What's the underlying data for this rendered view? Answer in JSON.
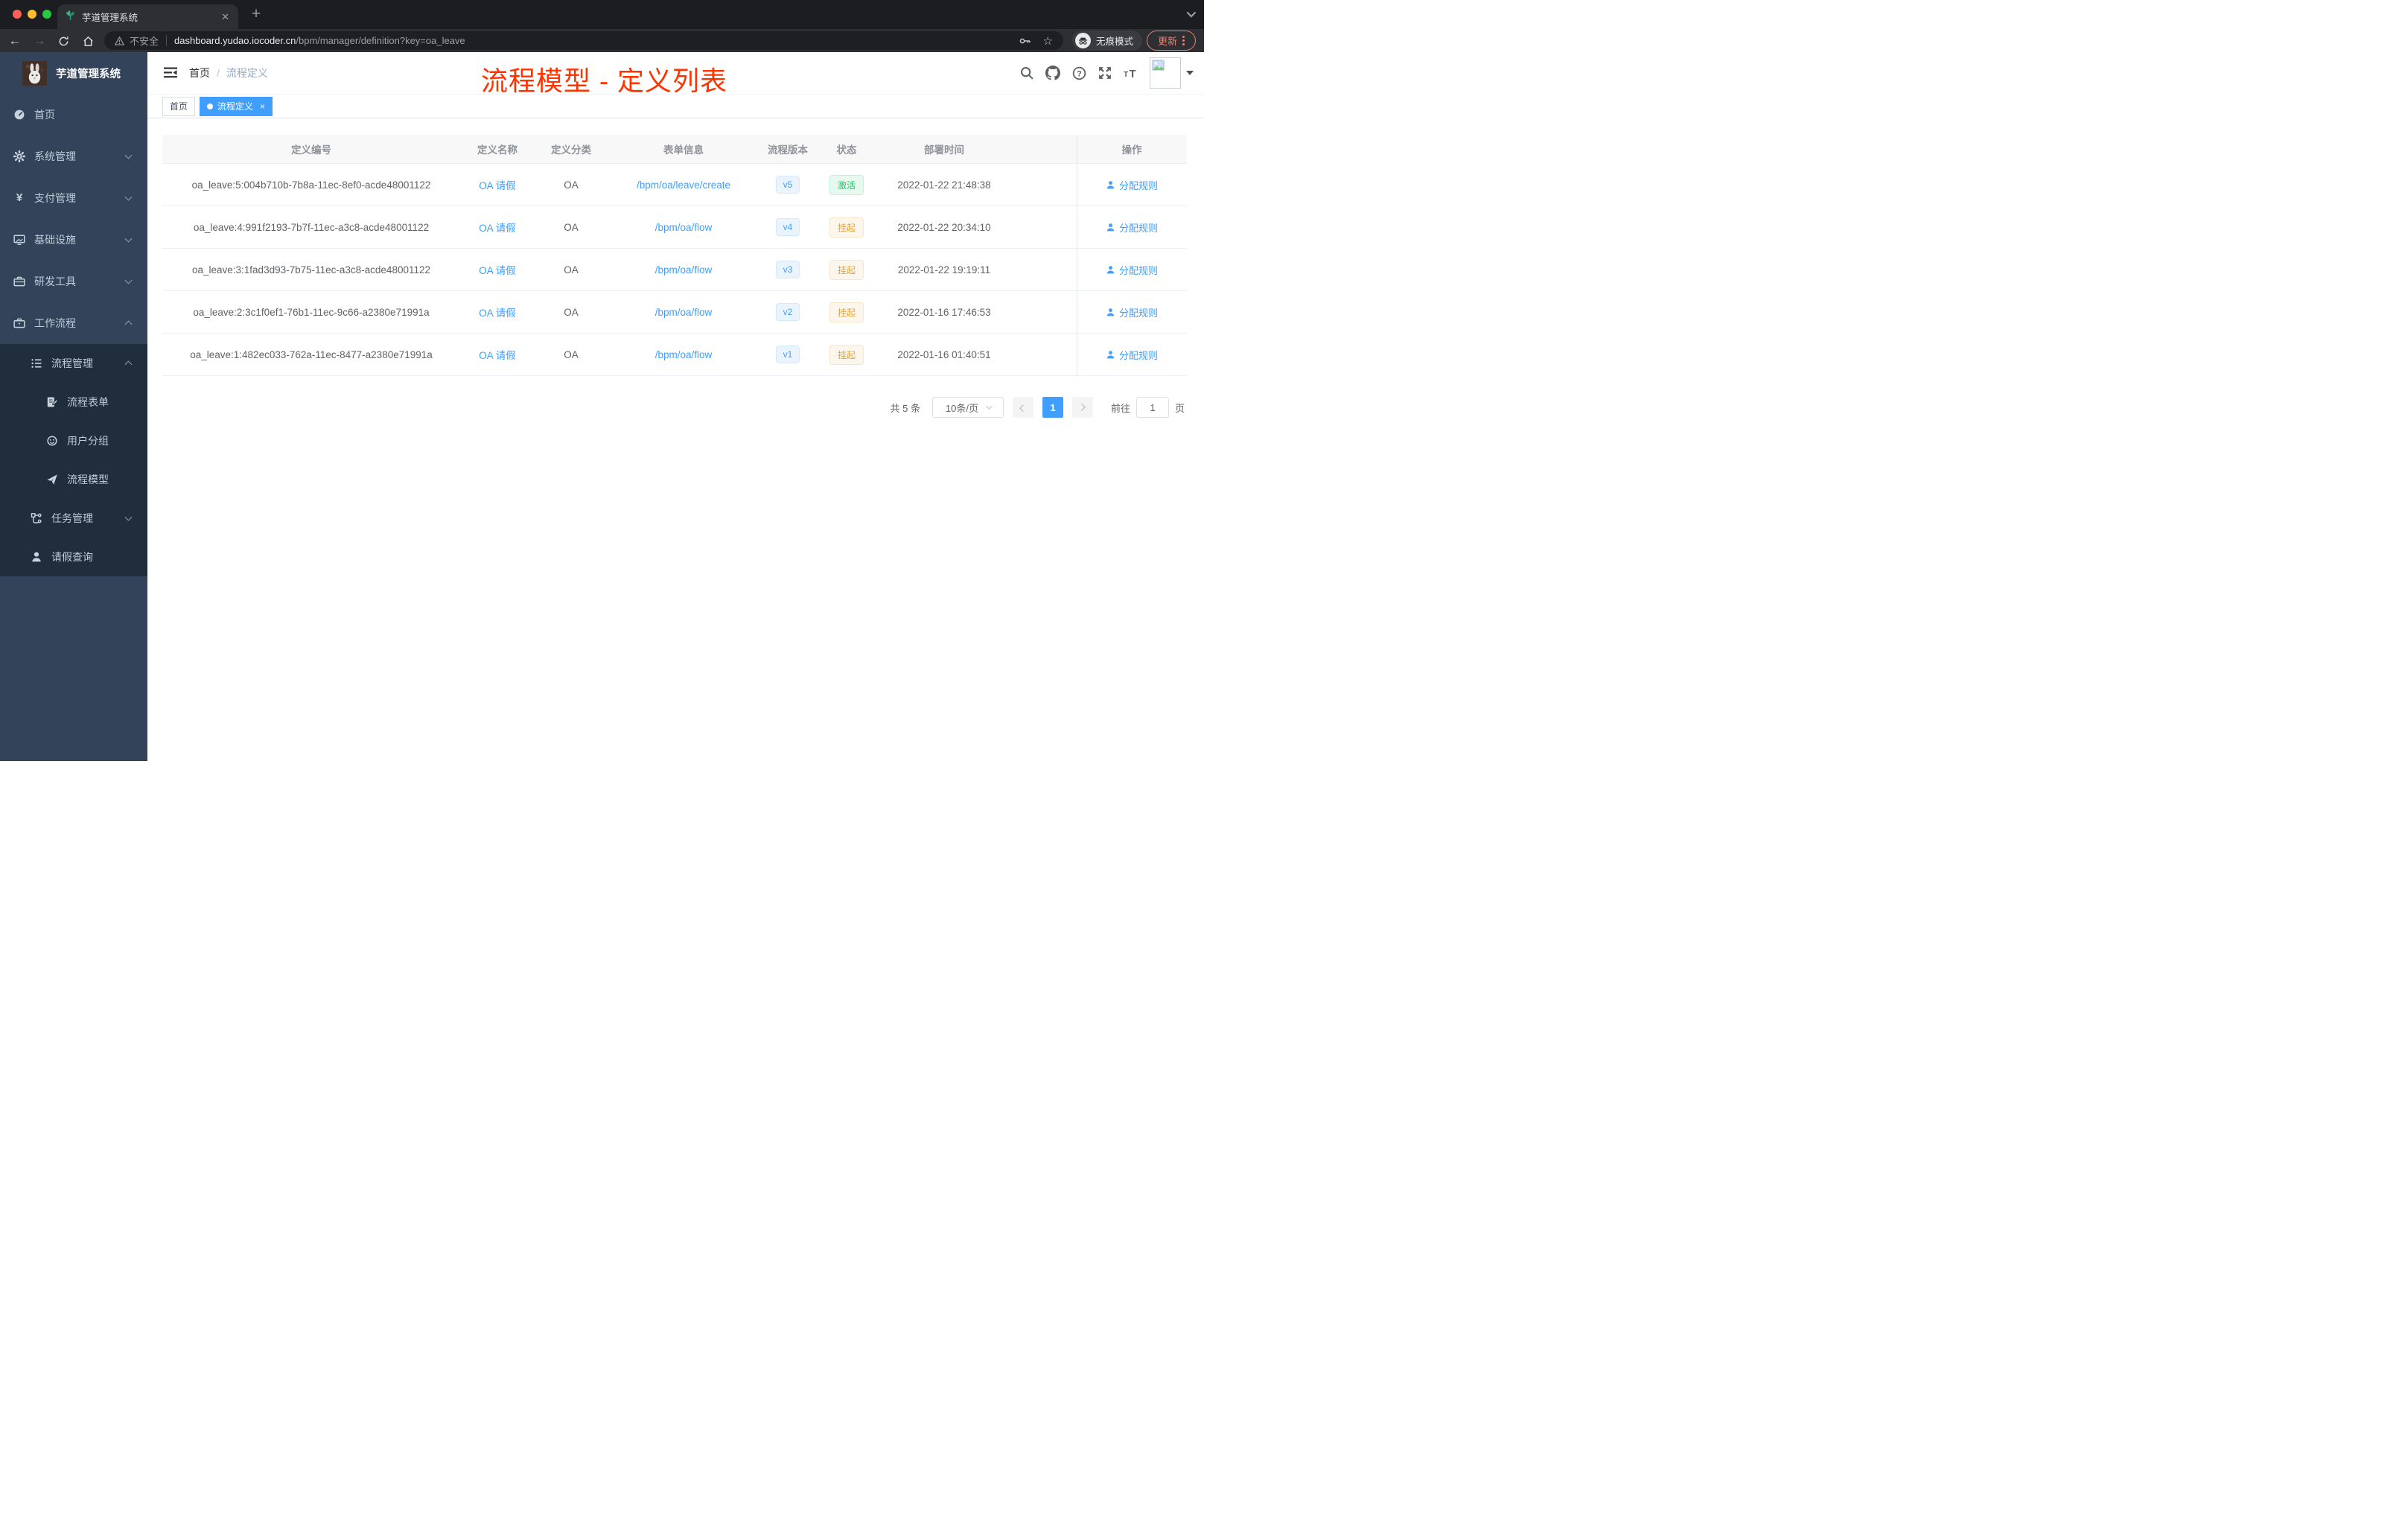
{
  "colors": {
    "accent": "#409eff",
    "success": "#13ce66",
    "warning": "#e6a23c",
    "annotation_red": "#ff3300",
    "sidebar_bg": "#33445a",
    "submenu_bg": "#1f2d3d"
  },
  "browser": {
    "tab_title": "芋道管理系统",
    "security_label": "不安全",
    "url_host": "dashboard.yudao.iocoder.cn",
    "url_path": "/bpm/manager/definition?key=oa_leave",
    "incognito_label": "无痕模式",
    "update_label": "更新"
  },
  "sidebar": {
    "logo_title": "芋道管理系统",
    "items": [
      {
        "key": "home",
        "icon": "dashboard-icon",
        "label": "首页",
        "level": 0,
        "chevron": "",
        "dark": false
      },
      {
        "key": "system",
        "icon": "gear-icon",
        "label": "系统管理",
        "level": 0,
        "chevron": "down",
        "dark": false
      },
      {
        "key": "payment",
        "icon": "yen-icon",
        "label": "支付管理",
        "level": 0,
        "chevron": "down",
        "dark": false
      },
      {
        "key": "infrastructure",
        "icon": "monitor-icon",
        "label": "基础设施",
        "level": 0,
        "chevron": "down",
        "dark": false
      },
      {
        "key": "dev-tools",
        "icon": "toolbox-icon",
        "label": "研发工具",
        "level": 0,
        "chevron": "down",
        "dark": false
      },
      {
        "key": "workflow",
        "icon": "briefcase-icon",
        "label": "工作流程",
        "level": 0,
        "chevron": "up",
        "dark": false
      },
      {
        "key": "process-manage",
        "icon": "list-icon",
        "label": "流程管理",
        "level": 1,
        "chevron": "up",
        "dark": true
      },
      {
        "key": "process-form",
        "icon": "form-icon",
        "label": "流程表单",
        "level": 2,
        "chevron": "",
        "dark": true
      },
      {
        "key": "user-group",
        "icon": "face-icon",
        "label": "用户分组",
        "level": 2,
        "chevron": "",
        "dark": true
      },
      {
        "key": "process-model",
        "icon": "paper-plane-icon",
        "label": "流程模型",
        "level": 2,
        "chevron": "",
        "dark": true
      },
      {
        "key": "task-manage",
        "icon": "tree-icon",
        "label": "任务管理",
        "level": 1,
        "chevron": "down",
        "dark": true
      },
      {
        "key": "leave-query",
        "icon": "user-icon",
        "label": "请假查询",
        "level": 1,
        "chevron": "",
        "dark": true
      }
    ]
  },
  "navbar": {
    "breadcrumb_home": "首页",
    "breadcrumb_separator": "/",
    "breadcrumb_current": "流程定义",
    "annotation": "流程模型 - 定义列表"
  },
  "tags": [
    {
      "label": "首页",
      "active": false
    },
    {
      "label": "流程定义",
      "active": true
    }
  ],
  "table": {
    "headers": [
      "定义编号",
      "定义名称",
      "定义分类",
      "表单信息",
      "流程版本",
      "状态",
      "部署时间",
      "操作"
    ],
    "rows": [
      {
        "id": "oa_leave:5:004b710b-7b8a-11ec-8ef0-acde48001122",
        "name": "OA 请假",
        "category": "OA",
        "form": "/bpm/oa/leave/create",
        "version": "v5",
        "status": "激活",
        "status_type": "success",
        "time": "2022-01-22 21:48:38",
        "action": "分配规则"
      },
      {
        "id": "oa_leave:4:991f2193-7b7f-11ec-a3c8-acde48001122",
        "name": "OA 请假",
        "category": "OA",
        "form": "/bpm/oa/flow",
        "version": "v4",
        "status": "挂起",
        "status_type": "warning",
        "time": "2022-01-22 20:34:10",
        "action": "分配规则"
      },
      {
        "id": "oa_leave:3:1fad3d93-7b75-11ec-a3c8-acde48001122",
        "name": "OA 请假",
        "category": "OA",
        "form": "/bpm/oa/flow",
        "version": "v3",
        "status": "挂起",
        "status_type": "warning",
        "time": "2022-01-22 19:19:11",
        "action": "分配规则"
      },
      {
        "id": "oa_leave:2:3c1f0ef1-76b1-11ec-9c66-a2380e71991a",
        "name": "OA 请假",
        "category": "OA",
        "form": "/bpm/oa/flow",
        "version": "v2",
        "status": "挂起",
        "status_type": "warning",
        "time": "2022-01-16 17:46:53",
        "action": "分配规则"
      },
      {
        "id": "oa_leave:1:482ec033-762a-11ec-8477-a2380e71991a",
        "name": "OA 请假",
        "category": "OA",
        "form": "/bpm/oa/flow",
        "version": "v1",
        "status": "挂起",
        "status_type": "warning",
        "time": "2022-01-16 01:40:51",
        "action": "分配规则"
      }
    ]
  },
  "pagination": {
    "total": "共 5 条",
    "page_size": "10条/页",
    "current": "1",
    "goto_label": "前往",
    "goto_value": "1",
    "unit": "页"
  }
}
